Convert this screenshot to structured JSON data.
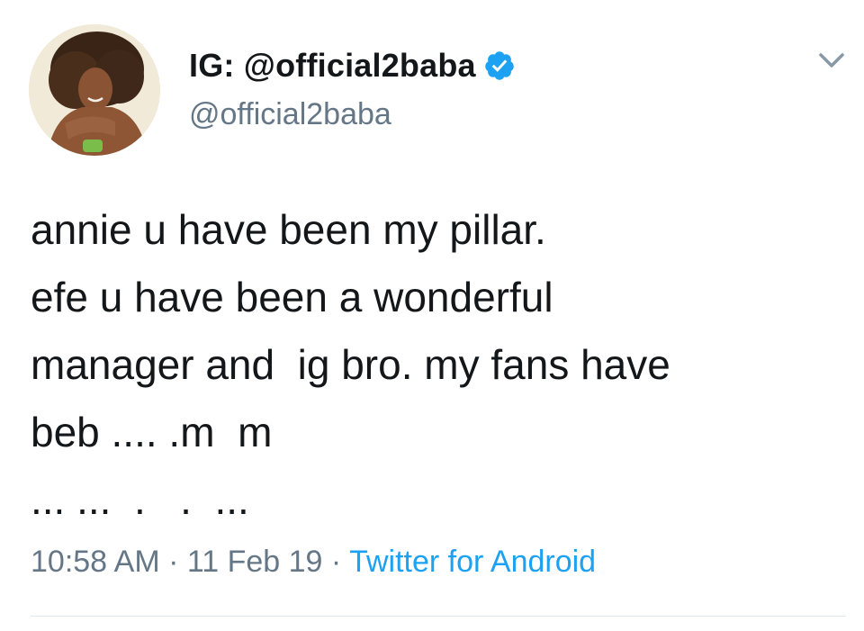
{
  "user": {
    "display_name": "IG: @official2baba",
    "handle": "@official2baba",
    "verified_icon": "verified-badge-icon",
    "avatar_icon": "profile-photo"
  },
  "menu": {
    "icon": "chevron-down-icon"
  },
  "tweet": {
    "lines": [
      "annie u have been my pillar.",
      "efe u have been a wonderful",
      "manager and  ig bro. my fans have",
      "beb .... .m  m",
      "... ...  .   .  ..."
    ]
  },
  "meta": {
    "time": "10:58 AM",
    "sep1": " · ",
    "date": "11 Feb 19",
    "sep2": " · ",
    "source": "Twitter for Android"
  },
  "colors": {
    "text": "#14171a",
    "secondary": "#657786",
    "accent": "#1da1f2",
    "divider": "#e1e8ed"
  }
}
